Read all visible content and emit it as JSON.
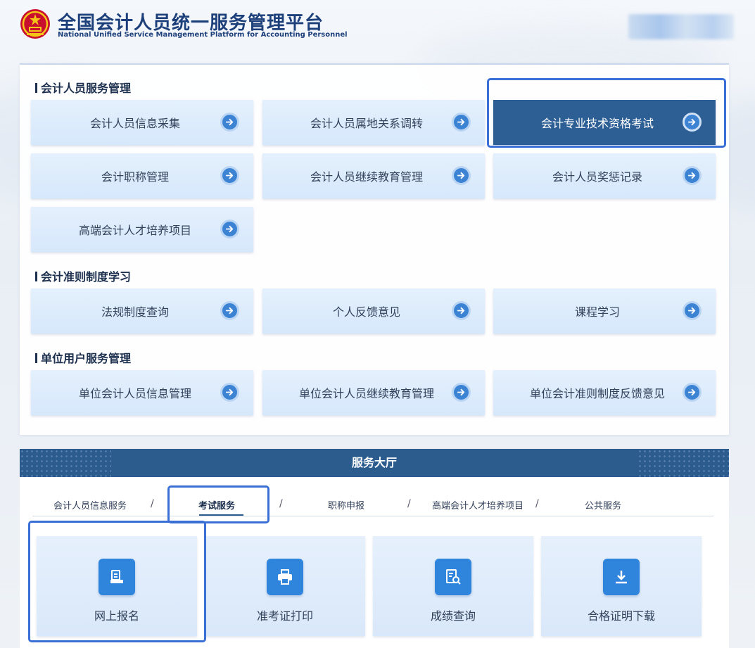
{
  "header": {
    "title_cn": "全国会计人员统一服务管理平台",
    "title_en": "National Unified Service Management Platform for Accounting Personnel"
  },
  "sections": [
    {
      "title": "会计人员服务管理",
      "items": [
        "会计人员信息采集",
        "会计人员属地关系调转",
        "会计专业技术资格考试",
        "会计职称管理",
        "会计人员继续教育管理",
        "会计人员奖惩记录",
        "高端会计人才培养项目"
      ]
    },
    {
      "title": "会计准则制度学习",
      "items": [
        "法规制度查询",
        "个人反馈意见",
        "课程学习"
      ]
    },
    {
      "title": "单位用户服务管理",
      "items": [
        "单位会计人员信息管理",
        "单位会计人员继续教育管理",
        "单位会计准则制度反馈意见"
      ]
    }
  ],
  "hall": {
    "title": "服务大厅",
    "tabs": [
      "会计人员信息服务",
      "考试服务",
      "职称申报",
      "高端会计人才培养项目",
      "公共服务"
    ],
    "separator": "/",
    "active_tab": "考试服务",
    "tiles": [
      {
        "label": "网上报名",
        "icon": "registration-icon"
      },
      {
        "label": "准考证打印",
        "icon": "printer-icon"
      },
      {
        "label": "成绩查询",
        "icon": "score-search-icon"
      },
      {
        "label": "合格证明下载",
        "icon": "download-icon"
      }
    ]
  },
  "colors": {
    "primary_dark": "#2c5b8e",
    "active_card": "#2d5f94",
    "highlight_border": "#3a6fd6",
    "card_bg": "#dbeafc",
    "icon_blue": "#2f84dc"
  }
}
